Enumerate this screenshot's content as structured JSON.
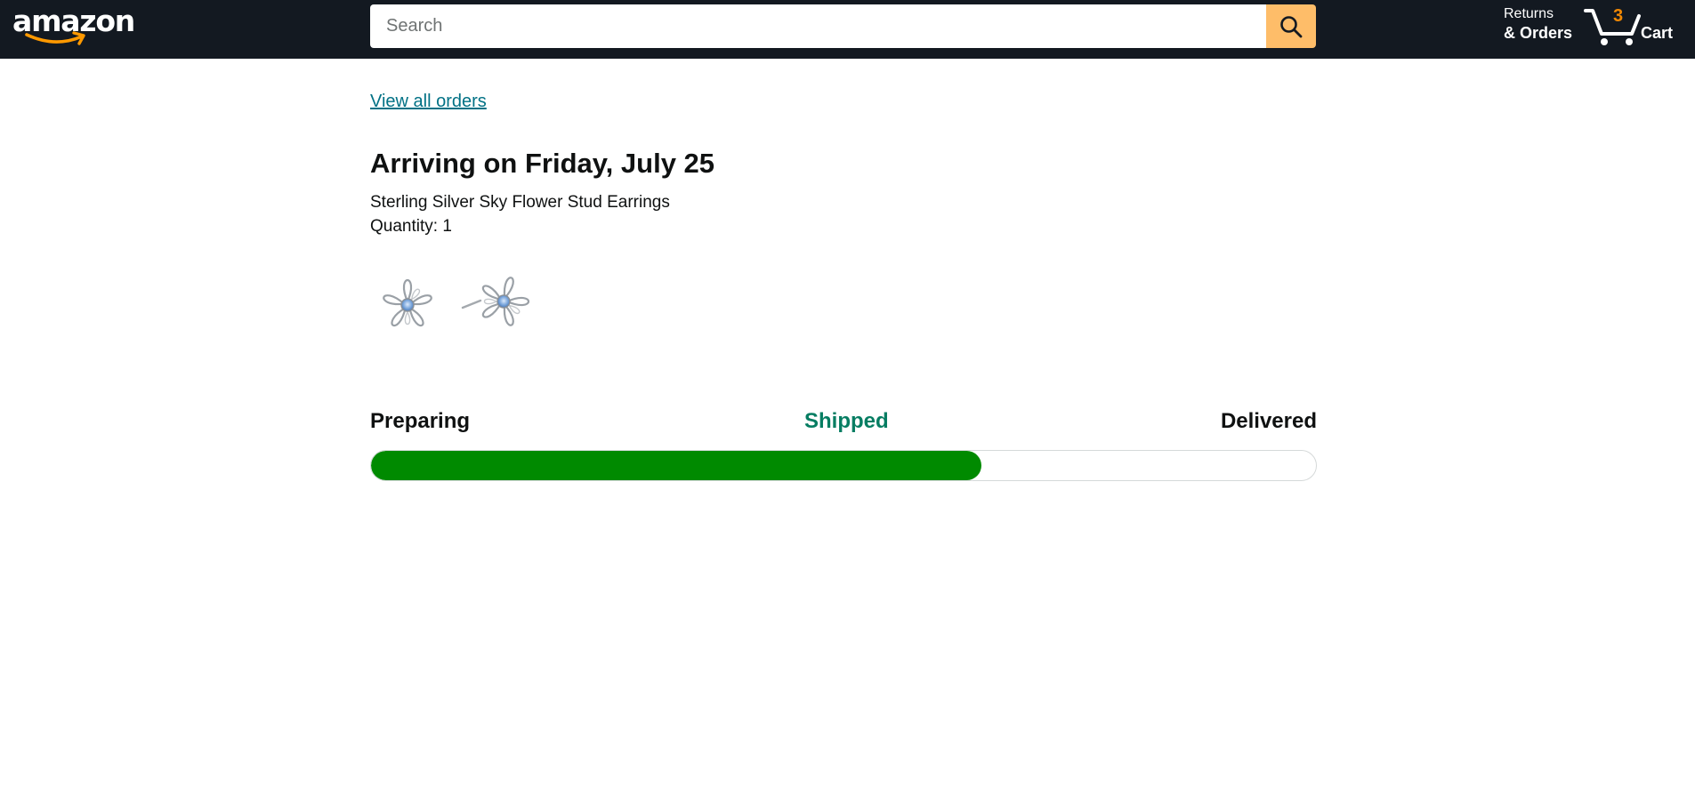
{
  "header": {
    "logo_text": "amazon",
    "search": {
      "placeholder": "Search",
      "value": ""
    },
    "returns_line1": "Returns",
    "returns_line2": "& Orders",
    "cart_count": "3",
    "cart_label": "Cart"
  },
  "main": {
    "view_all_orders": "View all orders",
    "arriving_title": "Arriving on Friday, July 25",
    "product_name": "Sterling Silver Sky Flower Stud Earrings",
    "quantity_label": "Quantity:",
    "quantity_value": "1",
    "product_image_icon": "flower-stud-earrings-image"
  },
  "tracking": {
    "steps": [
      "Preparing",
      "Shipped",
      "Delivered"
    ],
    "current_step": "Shipped",
    "progress_fraction": 0.646
  },
  "colors": {
    "header_bg": "#131921",
    "search_button": "#febd69",
    "link": "#007185",
    "current_step": "#067d62",
    "progress_fill": "#008a00",
    "cart_count": "#f08804"
  },
  "icons": {
    "search": "search-icon",
    "cart": "cart-icon",
    "logo_smile": "smile-arrow-icon"
  }
}
